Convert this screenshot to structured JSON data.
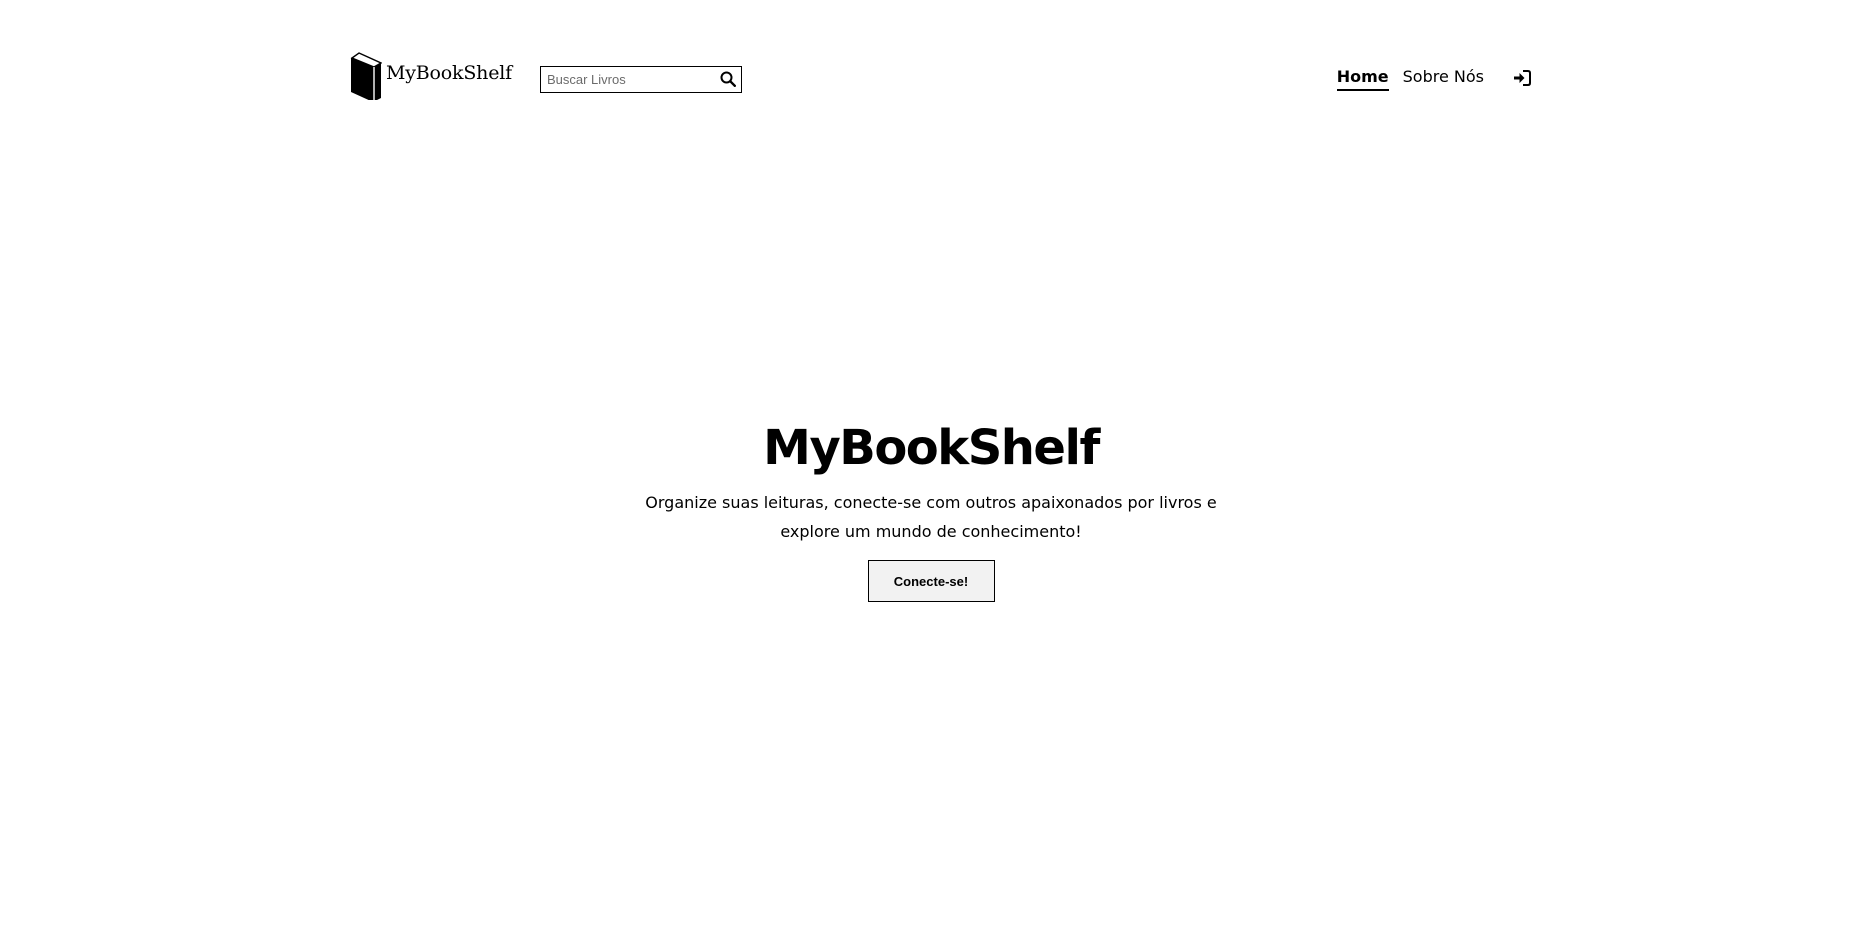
{
  "header": {
    "logo_text": "MyBookShelf",
    "logo_icon": "book-icon",
    "search": {
      "placeholder": "Buscar Livros",
      "value": "",
      "icon": "search-icon"
    },
    "nav": {
      "home_label": "Home",
      "about_label": "Sobre Nós",
      "active": "Home",
      "login_icon": "sign-in-icon"
    }
  },
  "hero": {
    "title": "MyBookShelf",
    "subtitle": "Organize suas leituras, conecte-se com outros apaixonados por livros e explore um mundo de conhecimento!",
    "cta_label": "Conecte-se!"
  },
  "colors": {
    "text": "#000000",
    "background": "#ffffff",
    "button_bg": "#f2f2f2"
  }
}
